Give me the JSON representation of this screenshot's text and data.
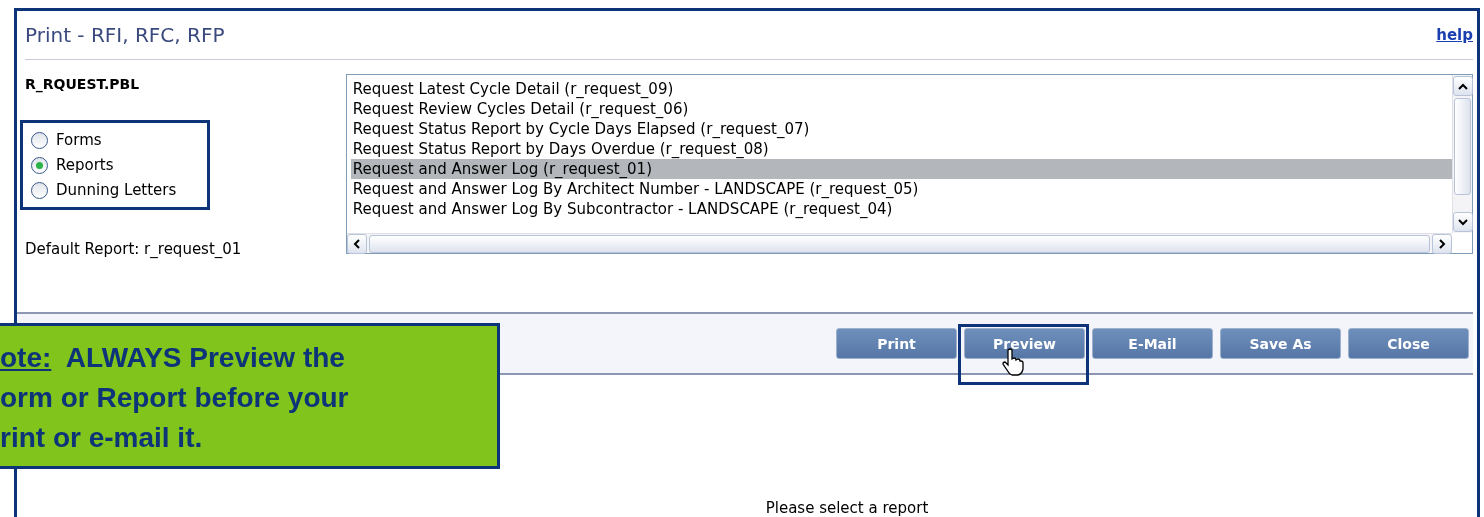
{
  "window": {
    "title": "Print - RFI, RFC, RFP",
    "help_link": "help"
  },
  "library": "R_RQUEST.PBL",
  "output_types": [
    {
      "label": "Forms",
      "selected": false
    },
    {
      "label": "Reports",
      "selected": true
    },
    {
      "label": "Dunning Letters",
      "selected": false
    }
  ],
  "default_report": "Default Report: r_request_01",
  "reports": [
    {
      "label": "Request Latest Cycle Detail (r_request_09)",
      "selected": false
    },
    {
      "label": "Request Review Cycles Detail (r_request_06)",
      "selected": false
    },
    {
      "label": "Request Status Report by Cycle Days Elapsed (r_request_07)",
      "selected": false
    },
    {
      "label": "Request Status Report by Days Overdue (r_request_08)",
      "selected": false
    },
    {
      "label": "Request and Answer Log (r_request_01)",
      "selected": true
    },
    {
      "label": "Request and Answer Log By Architect Number - LANDSCAPE (r_request_05)",
      "selected": false
    },
    {
      "label": "Request and Answer Log By Subcontractor - LANDSCAPE (r_request_04)",
      "selected": false
    }
  ],
  "buttons": [
    {
      "label": "Print",
      "highlighted": false
    },
    {
      "label": "Preview",
      "highlighted": true
    },
    {
      "label": "E-Mail",
      "highlighted": false
    },
    {
      "label": "Save As",
      "highlighted": false
    },
    {
      "label": "Close",
      "highlighted": false
    }
  ],
  "preview_message": "Please select a report",
  "callout": {
    "lead": "ote:",
    "lines": [
      "ALWAYS Preview the",
      "orm or Report before your",
      "rint or e-mail it."
    ]
  }
}
